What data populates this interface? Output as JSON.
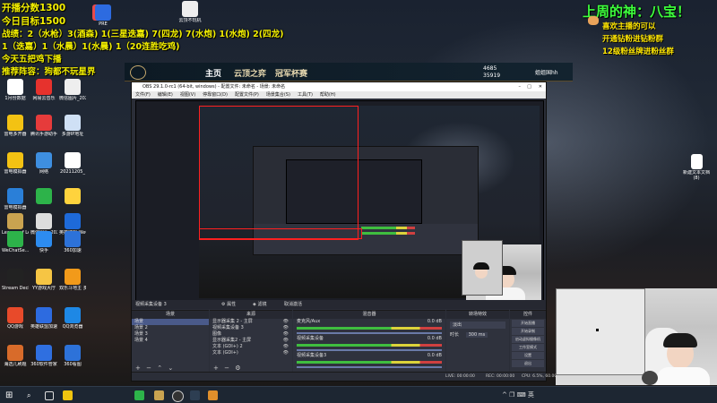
{
  "overlay_left": {
    "line1": "开播分数1300",
    "line2": "今日目标1500",
    "line3": "战绩：2（水枪）3(酒森) 1(三星迭嘉) 7(四龙) 7(水炮) 1(水炮) 2(四龙)",
    "line4": "1（迭嘉）1（水晨）1(水晨) 1（20连胜吃鸡)",
    "line5": "今天五把鸡下播",
    "line6": "推荐阵容：狗都不玩星界"
  },
  "overlay_right": {
    "title": "上周的神：八宝！",
    "line1": "喜欢主播的可以",
    "line2": "开通钻粉进钻粉群",
    "line3": "12级粉丝牌进粉丝群"
  },
  "desktop_icons": [
    {
      "label": "",
      "color": "#e84a4a"
    },
    {
      "label": "PRE",
      "color": "#2d6be0"
    },
    {
      "label": "云顶不玩机",
      "color": "#eeeeee"
    },
    {
      "label": "1月份数据",
      "color": "#ffffff"
    },
    {
      "label": "网易云音乐",
      "color": "#e6322d"
    },
    {
      "label": "微信图片_2022",
      "color": "#eeeeee"
    },
    {
      "label": "雷电多开器",
      "color": "#f3c213"
    },
    {
      "label": "腾讯手游助手",
      "color": "#e63b3b"
    },
    {
      "label": "多游IP地址",
      "color": "#cfe0f5"
    },
    {
      "label": "雷电模拟器",
      "color": "#f3c213"
    },
    {
      "label": "网络",
      "color": "#3e8fe0"
    },
    {
      "label": "20211205_",
      "color": "#ffffff"
    },
    {
      "label": "雷电模拟器",
      "color": "#2a7fd8"
    },
    {
      "label": "",
      "color": "#2db34a"
    },
    {
      "label": "",
      "color": "#ffd33d"
    },
    {
      "label": "League of Legends",
      "color": "#c9a350"
    },
    {
      "label": "微信图片_20220121",
      "color": "#dddddd"
    },
    {
      "label": "英雄联盟 WeGame版",
      "color": "#1e6ad9"
    },
    {
      "label": "WeChatSe...",
      "color": "#2db34a"
    },
    {
      "label": "快手",
      "color": "#2d8cf0"
    },
    {
      "label": "360加速",
      "color": "#2d72d9"
    },
    {
      "label": "Stream Deck",
      "color": "#222222"
    },
    {
      "label": "YY游戏大厅",
      "color": "#f6c544"
    },
    {
      "label": "双乐斗地主 多游戏加速",
      "color": "#f29a1a"
    },
    {
      "label": "QQ游戏",
      "color": "#e84a2a"
    },
    {
      "label": "英雄联盟加速",
      "color": "#2d6be0"
    },
    {
      "label": "QQ浏览器",
      "color": "#1e88e5"
    },
    {
      "label": "海选儿刷题",
      "color": "#d86b2a"
    },
    {
      "label": "360软件管家",
      "color": "#2f6fe0"
    },
    {
      "label": "360看图",
      "color": "#2d72d9"
    }
  ],
  "right_desktop_icon": {
    "label": "新建文本文档 (8)"
  },
  "game_client": {
    "tabs": [
      "主页",
      "云顶之弈",
      "冠军杯赛"
    ],
    "stat1": "4685",
    "stat2": "35919",
    "nickname": "姐姐国hh"
  },
  "obs": {
    "title": "OBS 29.1.0-rc1 (64-bit, windows) - 配置文件: 未命名 - 场景: 未命名",
    "menu": [
      "文件(F)",
      "编辑(E)",
      "视图(V)",
      "停靠窗口(D)",
      "配置文件(P)",
      "场景集合(S)",
      "工具(T)",
      "帮助(H)"
    ],
    "source_bar": {
      "label": "视频采集设备 3",
      "properties": "属性",
      "filters": "滤镜",
      "device": "取消激活"
    },
    "panels": {
      "scenes": "场景",
      "sources": "来源",
      "mixer": "混音器",
      "transitions": "转场特效",
      "controls": "控件"
    },
    "scenes": [
      "场景",
      "场景 2",
      "场景 3",
      "场景 4"
    ],
    "sources": [
      "显示器采集 2 - 主屏",
      "视频采集设备 3",
      "图像",
      "显示器采集2 - 主屏",
      "文本 (GDI+) 2",
      "文本 (GDI+)"
    ],
    "mixer": [
      {
        "name": "麦克风/Aux",
        "db": "0.0 dB"
      },
      {
        "name": "视频采集设备",
        "db": "0.0 dB"
      },
      {
        "name": "视频采集设备3",
        "db": "0.0 dB"
      }
    ],
    "transition": {
      "type": "淡出",
      "duration_label": "时长",
      "duration": "300 ms"
    },
    "controls": [
      "开始直播",
      "开始录制",
      "启动虚拟摄像机",
      "工作室模式",
      "设置",
      "退出"
    ],
    "status": {
      "live": "LIVE: 00:00:00",
      "rec": "REC: 00:00:00",
      "cpu": "CPU: 6.5%, 60.00 fps"
    }
  },
  "taskbar": {
    "icons": [
      "start-icon",
      "search-icon",
      "taskview-icon",
      "explorer-icon",
      "wechat-icon",
      "obs-icon",
      "game-icon",
      "steam-icon",
      "app-icon",
      "folder-icon"
    ],
    "tray": "^  ❐  ⌨  英"
  }
}
